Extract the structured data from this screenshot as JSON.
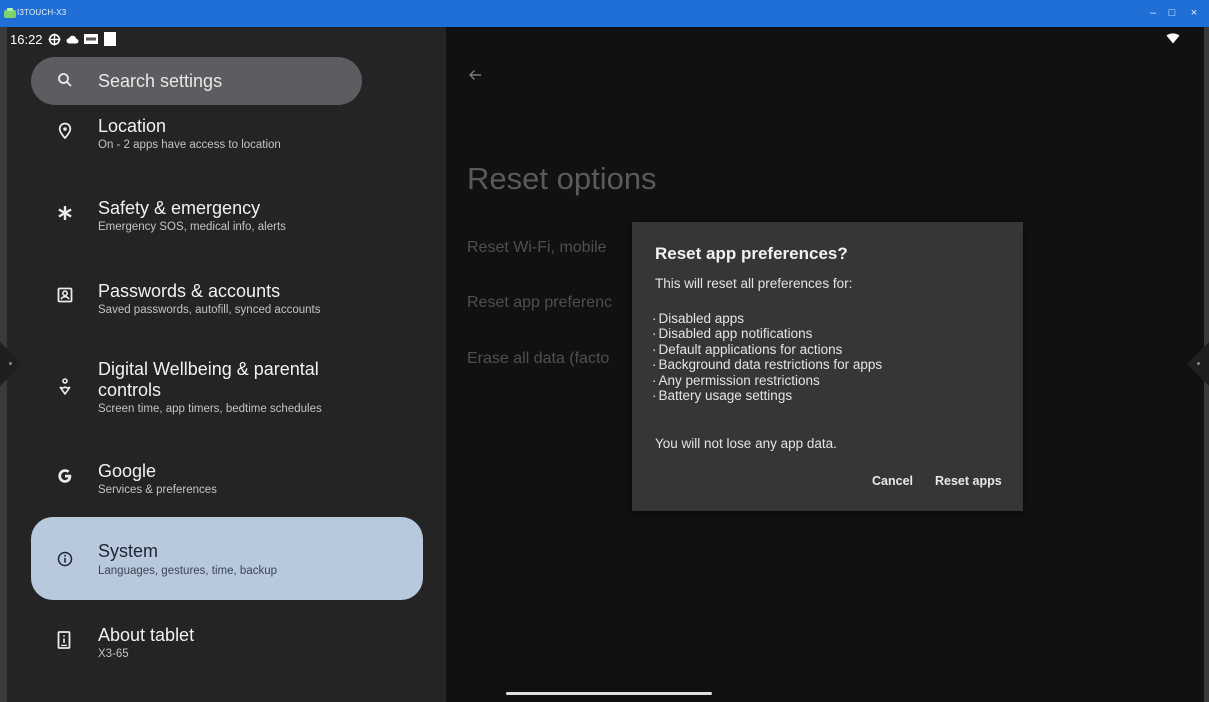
{
  "window": {
    "title": "I3TOUCH-X3",
    "minimize": "–",
    "maximize": "□",
    "close": "×"
  },
  "status_bar": {
    "time": "16:22"
  },
  "search": {
    "placeholder": "Search settings"
  },
  "settings_list": [
    {
      "title": "Location",
      "subtitle": "On - 2 apps have access to location",
      "icon": "location-pin-icon"
    },
    {
      "title": "Safety & emergency",
      "subtitle": "Emergency SOS, medical info, alerts",
      "icon": "asterisk-icon"
    },
    {
      "title": "Passwords & accounts",
      "subtitle": "Saved passwords, autofill, synced accounts",
      "icon": "account-box-icon"
    },
    {
      "title": "Digital Wellbeing & parental controls",
      "title_line1": "Digital Wellbeing & parental",
      "title_line2": "controls",
      "subtitle": "Screen time, app timers, bedtime schedules",
      "icon": "wellbeing-icon"
    },
    {
      "title": "Google",
      "subtitle": "Services & preferences",
      "icon": "google-g-icon"
    },
    {
      "title": "System",
      "subtitle": "Languages, gestures, time, backup",
      "icon": "info-circle-icon",
      "selected": true
    },
    {
      "title": "About tablet",
      "subtitle": "X3-65",
      "icon": "tablet-info-icon"
    }
  ],
  "reset_page": {
    "title": "Reset options",
    "options": [
      "Reset Wi-Fi, mobile",
      "Reset app preferenc",
      "Erase all data (facto"
    ]
  },
  "dialog": {
    "title": "Reset app preferences?",
    "intro": "This will reset all preferences for:",
    "items": [
      "Disabled apps",
      "Disabled app notifications",
      "Default applications for actions",
      "Background data restrictions for apps",
      "Any permission restrictions",
      "Battery usage settings"
    ],
    "note": "You will not lose any app data.",
    "cancel_label": "Cancel",
    "confirm_label": "Reset apps"
  },
  "colors": {
    "title_bar": "#1f6fd6",
    "selected_item": "#b8c9dd",
    "dialog_bg": "#363636",
    "left_pane": "#242424",
    "right_pane": "#111111"
  }
}
